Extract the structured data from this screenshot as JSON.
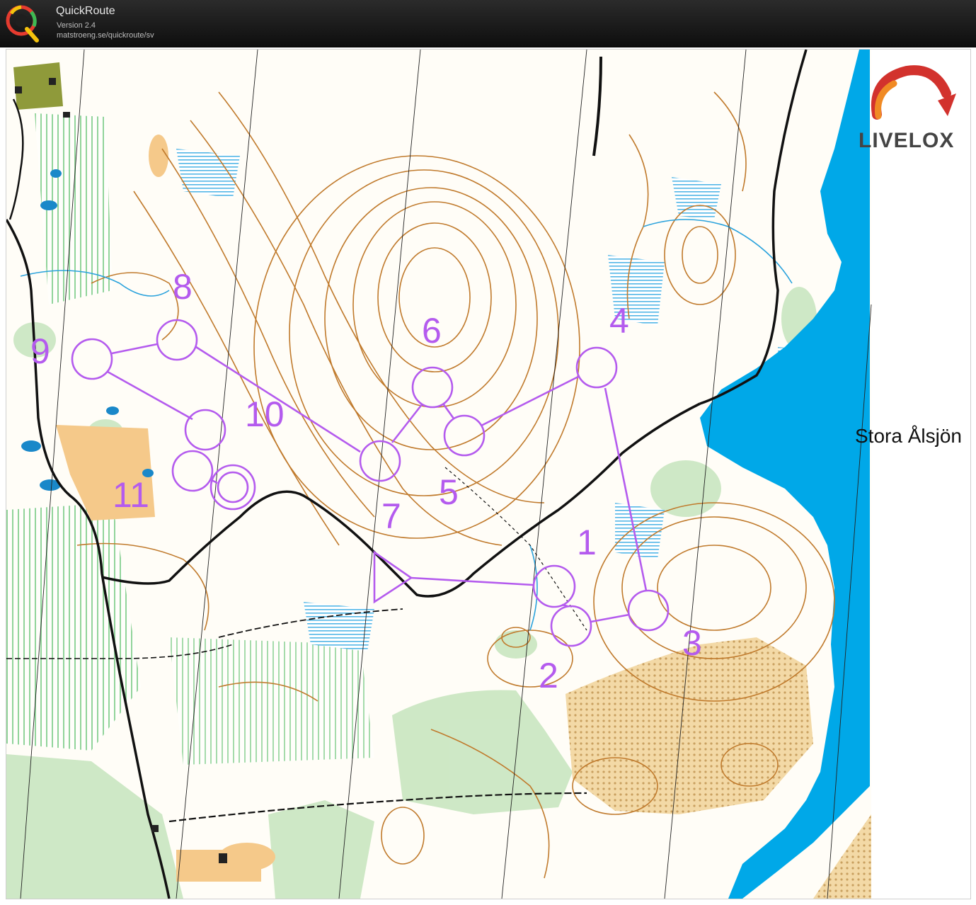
{
  "app": {
    "name": "QuickRoute",
    "version": "Version 2.4",
    "url": "matstroeng.se/quickroute/sv"
  },
  "map": {
    "lake_label": "Stora Ålsjön",
    "logo_text": "LIVELOX",
    "course_color": "#b45bee",
    "water_color": "#00a8e8",
    "contour_color": "#c07a2c",
    "vegetation_color": "#c9e6c0",
    "open_land_color": "#f5c98a",
    "controls": [
      {
        "number": "1"
      },
      {
        "number": "2"
      },
      {
        "number": "3"
      },
      {
        "number": "4"
      },
      {
        "number": "5"
      },
      {
        "number": "6"
      },
      {
        "number": "7"
      },
      {
        "number": "8"
      },
      {
        "number": "9"
      },
      {
        "number": "10"
      },
      {
        "number": "11"
      }
    ]
  }
}
